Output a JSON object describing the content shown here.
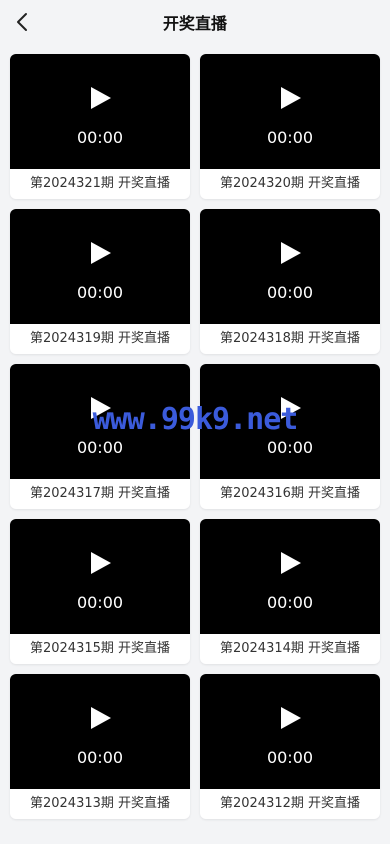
{
  "header": {
    "title": "开奖直播",
    "back_icon": "chevron-left-icon"
  },
  "videos": [
    {
      "duration": "00:00",
      "caption": "第2024321期 开奖直播"
    },
    {
      "duration": "00:00",
      "caption": "第2024320期 开奖直播"
    },
    {
      "duration": "00:00",
      "caption": "第2024319期 开奖直播"
    },
    {
      "duration": "00:00",
      "caption": "第2024318期 开奖直播"
    },
    {
      "duration": "00:00",
      "caption": "第2024317期 开奖直播"
    },
    {
      "duration": "00:00",
      "caption": "第2024316期 开奖直播"
    },
    {
      "duration": "00:00",
      "caption": "第2024315期 开奖直播"
    },
    {
      "duration": "00:00",
      "caption": "第2024314期 开奖直播"
    },
    {
      "duration": "00:00",
      "caption": "第2024313期 开奖直播"
    },
    {
      "duration": "00:00",
      "caption": "第2024312期 开奖直播"
    }
  ],
  "watermark": "www.99k9.net",
  "colors": {
    "background": "#f3f4f6",
    "video_bg": "#000000",
    "watermark": "#3b5bdb"
  }
}
